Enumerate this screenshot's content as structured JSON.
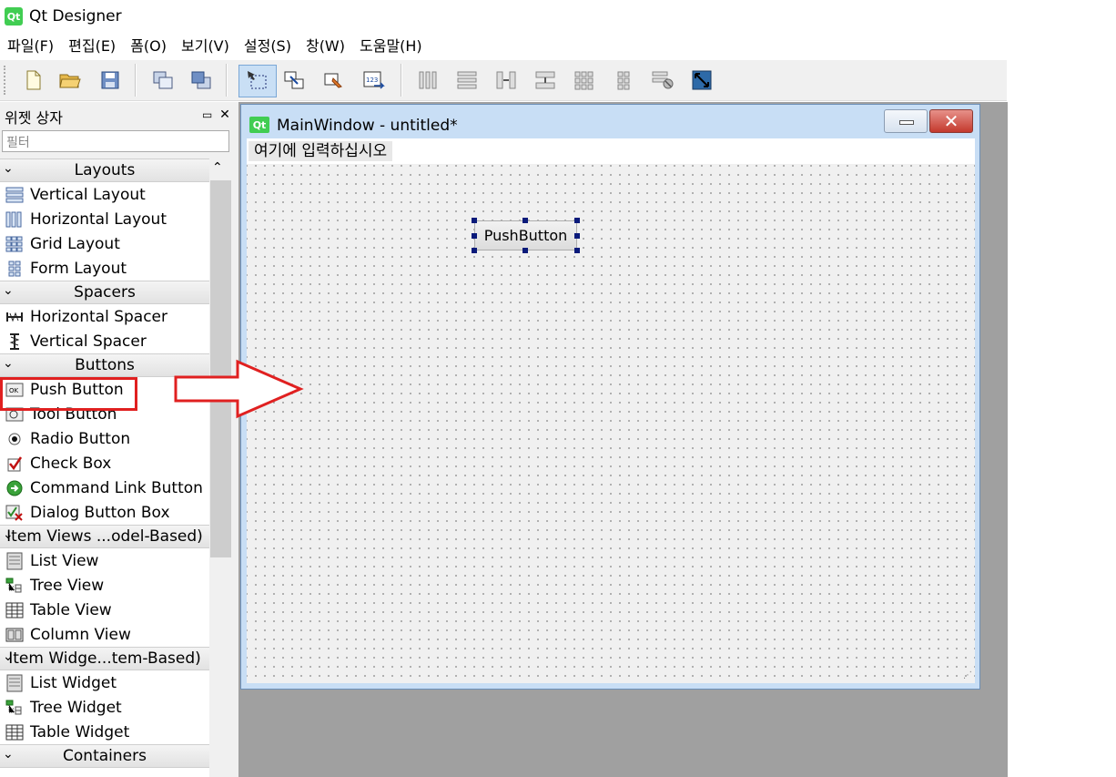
{
  "app": {
    "title": "Qt Designer",
    "icon": "Qt"
  },
  "menubar": [
    "파일(F)",
    "편집(E)",
    "폼(O)",
    "보기(V)",
    "설정(S)",
    "창(W)",
    "도움말(H)"
  ],
  "widget_box": {
    "title": "위젯 상자",
    "filter_placeholder": "필터",
    "categories": [
      {
        "label": "Layouts",
        "items": [
          "Vertical Layout",
          "Horizontal Layout",
          "Grid Layout",
          "Form Layout"
        ]
      },
      {
        "label": "Spacers",
        "items": [
          "Horizontal Spacer",
          "Vertical Spacer"
        ]
      },
      {
        "label": "Buttons",
        "items": [
          "Push Button",
          "Tool Button",
          "Radio Button",
          "Check Box",
          "Command Link Button",
          "Dialog Button Box"
        ]
      },
      {
        "label": "Item Views ...odel-Based)",
        "items": [
          "List View",
          "Tree View",
          "Table View",
          "Column View"
        ]
      },
      {
        "label": "Item Widge...tem-Based)",
        "items": [
          "List Widget",
          "Tree Widget",
          "Table Widget"
        ]
      },
      {
        "label": "Containers",
        "items": []
      }
    ]
  },
  "main_window": {
    "icon": "Qt",
    "title": "MainWindow - untitled*",
    "menu_placeholder": "여기에 입력하십시오",
    "button_text": "PushButton"
  },
  "colors": {
    "highlight": "#e02020",
    "qt_green": "#41cd52",
    "selection": "#0a1a7a"
  }
}
